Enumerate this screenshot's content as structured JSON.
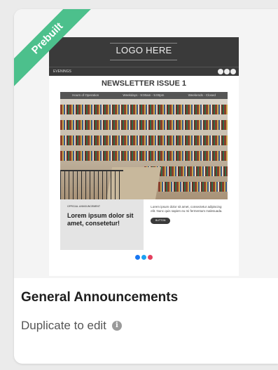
{
  "badge": {
    "label": "Prebuilt"
  },
  "preview": {
    "logo_text": "LOGO HERE",
    "subbar_left": "EVENINGS",
    "issue_title": "NEWSLETTER ISSUE 1",
    "hours": [
      "Hours of Operation",
      "Weekdays - 9:00am - 5:00pm",
      "Weekends - Closed"
    ],
    "official": "OFFICIAL ANNOUNCEMENT",
    "lorem_big": "Lorem ipsum dolor sit amet, consetetur!",
    "lorem_small": "Lorem ipsum dolor sit amet, consectetur adipiscing elit. Nunc quis sapien eu mi fermentum malesuada.",
    "button": "BUTTON",
    "social_colors": [
      "#1877f2",
      "#1da1f2",
      "#e4405f"
    ]
  },
  "card": {
    "title": "General Announcements",
    "subtitle": "Duplicate to edit",
    "info_glyph": "i"
  },
  "colors": {
    "badge": "#4cc08c",
    "header": "#3a3a3a"
  }
}
